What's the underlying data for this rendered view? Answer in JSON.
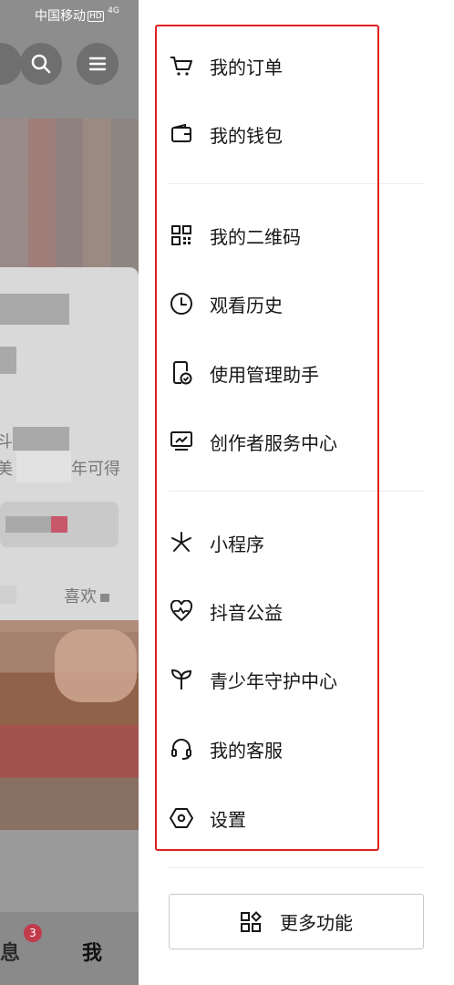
{
  "status_bar": {
    "carrier": "中国移动",
    "hd": "HD",
    "network": "4G"
  },
  "background_page": {
    "partial_text_1": "斗",
    "partial_text_2": "美",
    "partial_text_3": "年可得",
    "likes_tab": "喜欢",
    "tab_messages": "消息",
    "tab_messages_visible": "息",
    "messages_badge": "3",
    "tab_me": "我"
  },
  "menu": {
    "group1": [
      {
        "label": "我的订单",
        "icon": "cart-icon"
      },
      {
        "label": "我的钱包",
        "icon": "wallet-icon"
      }
    ],
    "group2": [
      {
        "label": "我的二维码",
        "icon": "qr-code-icon"
      },
      {
        "label": "观看历史",
        "icon": "clock-icon"
      },
      {
        "label": "使用管理助手",
        "icon": "phone-check-icon"
      },
      {
        "label": "创作者服务中心",
        "icon": "monitor-chart-icon"
      }
    ],
    "group3": [
      {
        "label": "小程序",
        "icon": "asterisk-icon"
      },
      {
        "label": "抖音公益",
        "icon": "heart-pulse-icon"
      },
      {
        "label": "青少年守护中心",
        "icon": "sprout-icon"
      },
      {
        "label": "我的客服",
        "icon": "headset-icon"
      },
      {
        "label": "设置",
        "icon": "hexagon-settings-icon"
      }
    ]
  },
  "more_button": {
    "label": "更多功能",
    "icon": "grid-shapes-icon"
  },
  "colors": {
    "highlight_border": "#e02020",
    "badge": "#c23b4b"
  }
}
